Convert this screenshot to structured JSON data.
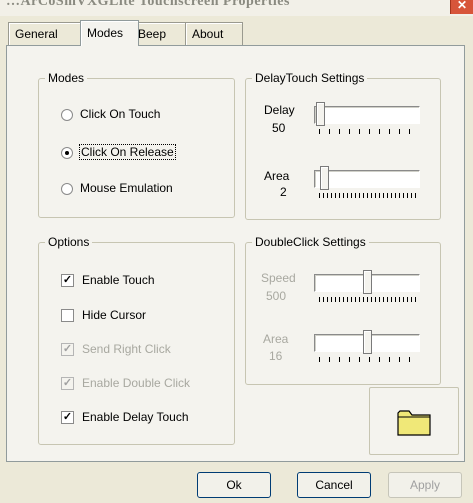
{
  "window": {
    "title": "…ArCoSmVXGLite Touchscreen Properties"
  },
  "tabs": [
    {
      "label": "General"
    },
    {
      "label": "Modes"
    },
    {
      "label": "Beep"
    },
    {
      "label": "About"
    }
  ],
  "modes_group": {
    "title": "Modes",
    "options": [
      {
        "label": "Click On Touch",
        "selected": false
      },
      {
        "label": "Click On Release",
        "selected": true
      },
      {
        "label": "Mouse Emulation",
        "selected": false
      }
    ]
  },
  "delay_touch": {
    "title": "DelayTouch Settings",
    "delay": {
      "label": "Delay",
      "value": "50",
      "level": 0.0
    },
    "area": {
      "label": "Area",
      "value": "2",
      "level": 0.06
    }
  },
  "options_group": {
    "title": "Options",
    "items": [
      {
        "label": "Enable Touch",
        "checked": true,
        "enabled": true
      },
      {
        "label": "Hide Cursor",
        "checked": false,
        "enabled": true
      },
      {
        "label": "Send Right Click",
        "checked": true,
        "enabled": false
      },
      {
        "label": "Enable Double Click",
        "checked": true,
        "enabled": false
      },
      {
        "label": "Enable Delay Touch",
        "checked": true,
        "enabled": true
      }
    ]
  },
  "double_click": {
    "title": "DoubleClick Settings",
    "speed": {
      "label": "Speed",
      "value": "500",
      "level": 0.5
    },
    "area": {
      "label": "Area",
      "value": "16",
      "level": 0.5
    }
  },
  "folder": {
    "icon": "folder-icon",
    "color": "#f0e878"
  },
  "buttons": {
    "ok": "Ok",
    "cancel": "Cancel",
    "apply": "Apply"
  }
}
